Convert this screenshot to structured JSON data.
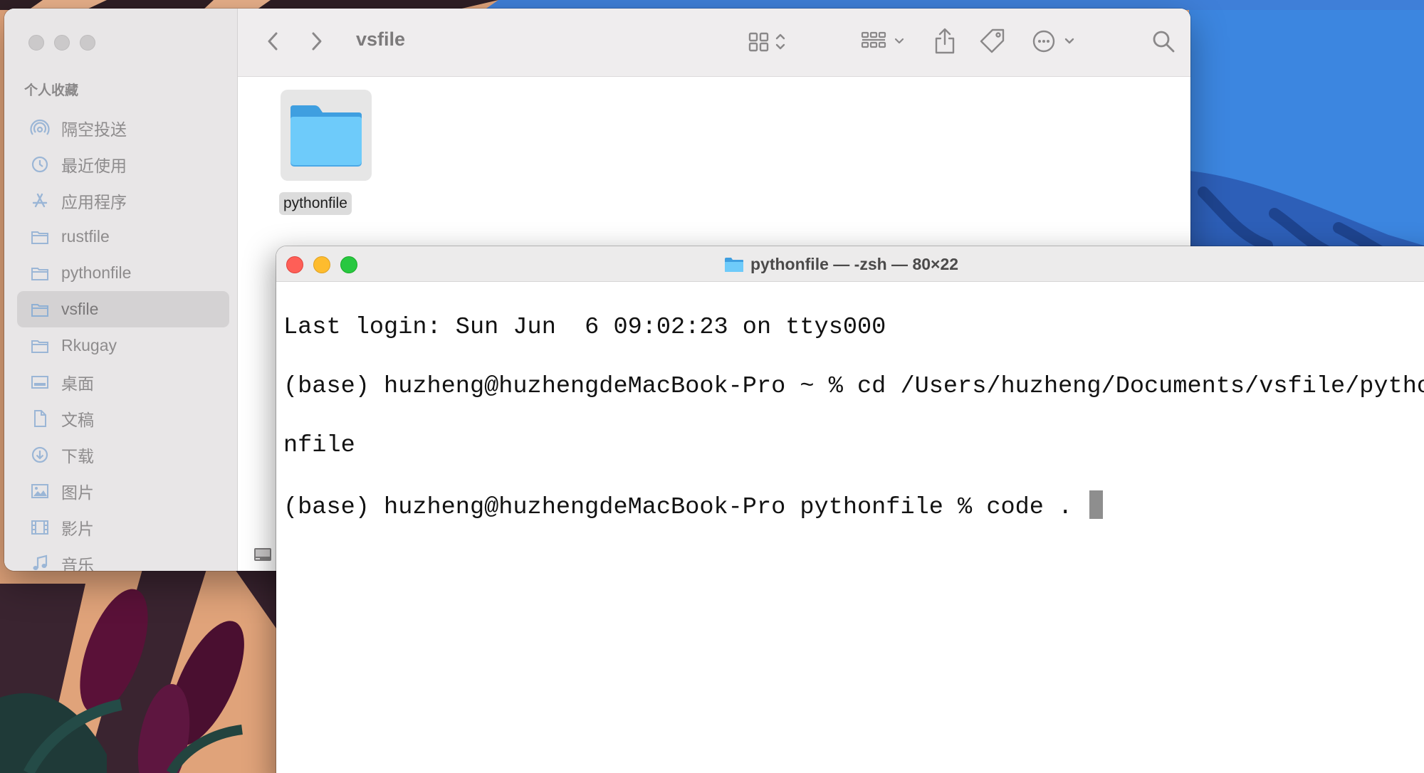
{
  "finder": {
    "title": "vsfile",
    "sidebar_heading": "个人收藏",
    "sidebar_items": [
      {
        "label": "隔空投送",
        "icon": "airdrop-icon"
      },
      {
        "label": "最近使用",
        "icon": "clock-icon"
      },
      {
        "label": "应用程序",
        "icon": "applications-icon"
      },
      {
        "label": "rustfile",
        "icon": "folder-icon"
      },
      {
        "label": "pythonfile",
        "icon": "folder-icon"
      },
      {
        "label": "vsfile",
        "icon": "folder-icon",
        "selected": true
      },
      {
        "label": "Rkugay",
        "icon": "folder-icon"
      },
      {
        "label": "桌面",
        "icon": "desktop-icon"
      },
      {
        "label": "文稿",
        "icon": "document-icon"
      },
      {
        "label": "下载",
        "icon": "download-icon"
      },
      {
        "label": "图片",
        "icon": "pictures-icon"
      },
      {
        "label": "影片",
        "icon": "movies-icon"
      },
      {
        "label": "音乐",
        "icon": "music-icon"
      }
    ],
    "toolbar_icons": [
      "back-icon",
      "forward-icon",
      "grid-view-icon",
      "group-icon",
      "share-icon",
      "tag-icon",
      "more-icon",
      "search-icon"
    ],
    "items": [
      {
        "name": "pythonfile",
        "type": "folder",
        "selected": true
      }
    ]
  },
  "terminal": {
    "title": "pythonfile — -zsh — 80×22",
    "lines": [
      "Last login: Sun Jun  6 09:02:23 on ttys000",
      "(base) huzheng@huzhengdeMacBook-Pro ~ % cd /Users/huzheng/Documents/vsfile/pytho",
      "nfile",
      "(base) huzheng@huzhengdeMacBook-Pro pythonfile % code . "
    ]
  },
  "colors": {
    "accent_folder": "#5ac8fa",
    "close": "#fe5f57",
    "minimize": "#febc2e",
    "zoom": "#28c840"
  }
}
